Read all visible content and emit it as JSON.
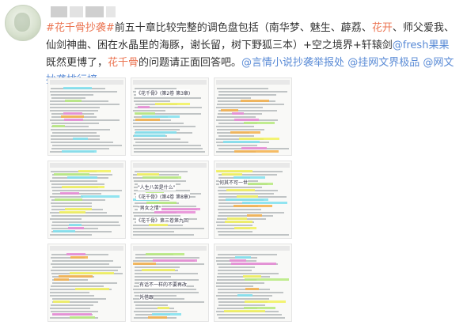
{
  "post": {
    "hashtag": "#花千骨抄袭#",
    "body_1": "前五十章比较完整的调色盘包括（南华梦、魅生、薜荔、",
    "keyword_1": "花开",
    "body_2": "、师父爱我、仙剑神曲、困在水晶里的海豚，谢长留，树下野狐三本）+空之境界+轩辕剑",
    "mention_1": "@fresh果果",
    "body_3": " 既然更博了，",
    "keyword_2": "花千骨",
    "body_4": "的问题请正面回答吧。",
    "mention_2": "@言情小说抄袭举报处",
    "mention_3": "@挂网文界极品",
    "mention_4": "@网文抄袭排行榜"
  },
  "images": {
    "count": 9,
    "highlight_colors": [
      "#f2f25a",
      "#7fe0ef",
      "#b6ea7d",
      "#f5b04a",
      "#e88ad6"
    ],
    "note_1": "《花千骨》(第2卷 第3章)",
    "note_2": "《花千骨》(第4卷 第8章)",
    "note_3": "\"人生八苦是什么\"",
    "note_4": "《花千骨》第三卷第九回",
    "note_5": "\"男女之情\"",
    "note_6": "何其不可一世",
    "note_7": "有话不一样的不要再改",
    "note_8": "凭借跟"
  }
}
